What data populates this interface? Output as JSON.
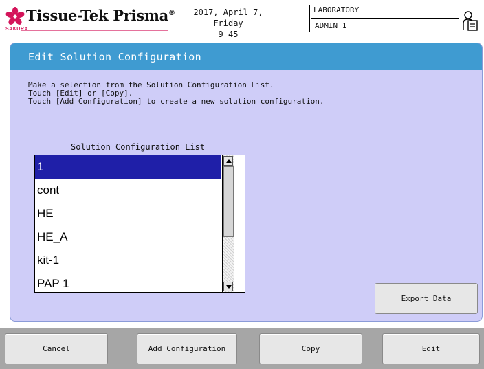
{
  "header": {
    "logo_text": "Tissue-Tek Prisma",
    "logo_reg": "®",
    "logo_sub": "SAKURA",
    "date": "2017, April 7, Friday",
    "time": "9 45",
    "location": "LABORATORY",
    "user": "ADMIN 1"
  },
  "panel": {
    "title": "Edit Solution Configuration",
    "instructions": [
      "Make a selection from the Solution Configuration List.",
      "Touch [Edit] or [Copy].",
      "Touch [Add Configuration] to create a new solution configuration."
    ],
    "list_caption": "Solution Configuration List",
    "list_items": [
      "1",
      "cont",
      "HE",
      "HE_A",
      "kit-1",
      "PAP 1"
    ],
    "selected_index": 0,
    "export_label": "Export Data"
  },
  "footer": {
    "cancel_label": "Cancel",
    "add_label": "Add Configuration",
    "copy_label": "Copy",
    "edit_label": "Edit"
  },
  "colors": {
    "panel_bg": "#cfcdf8",
    "header_bar": "#3f9bd1",
    "selection": "#1f1fa8",
    "bottom_bar": "#a6a6a6",
    "brand": "#d4145a"
  }
}
